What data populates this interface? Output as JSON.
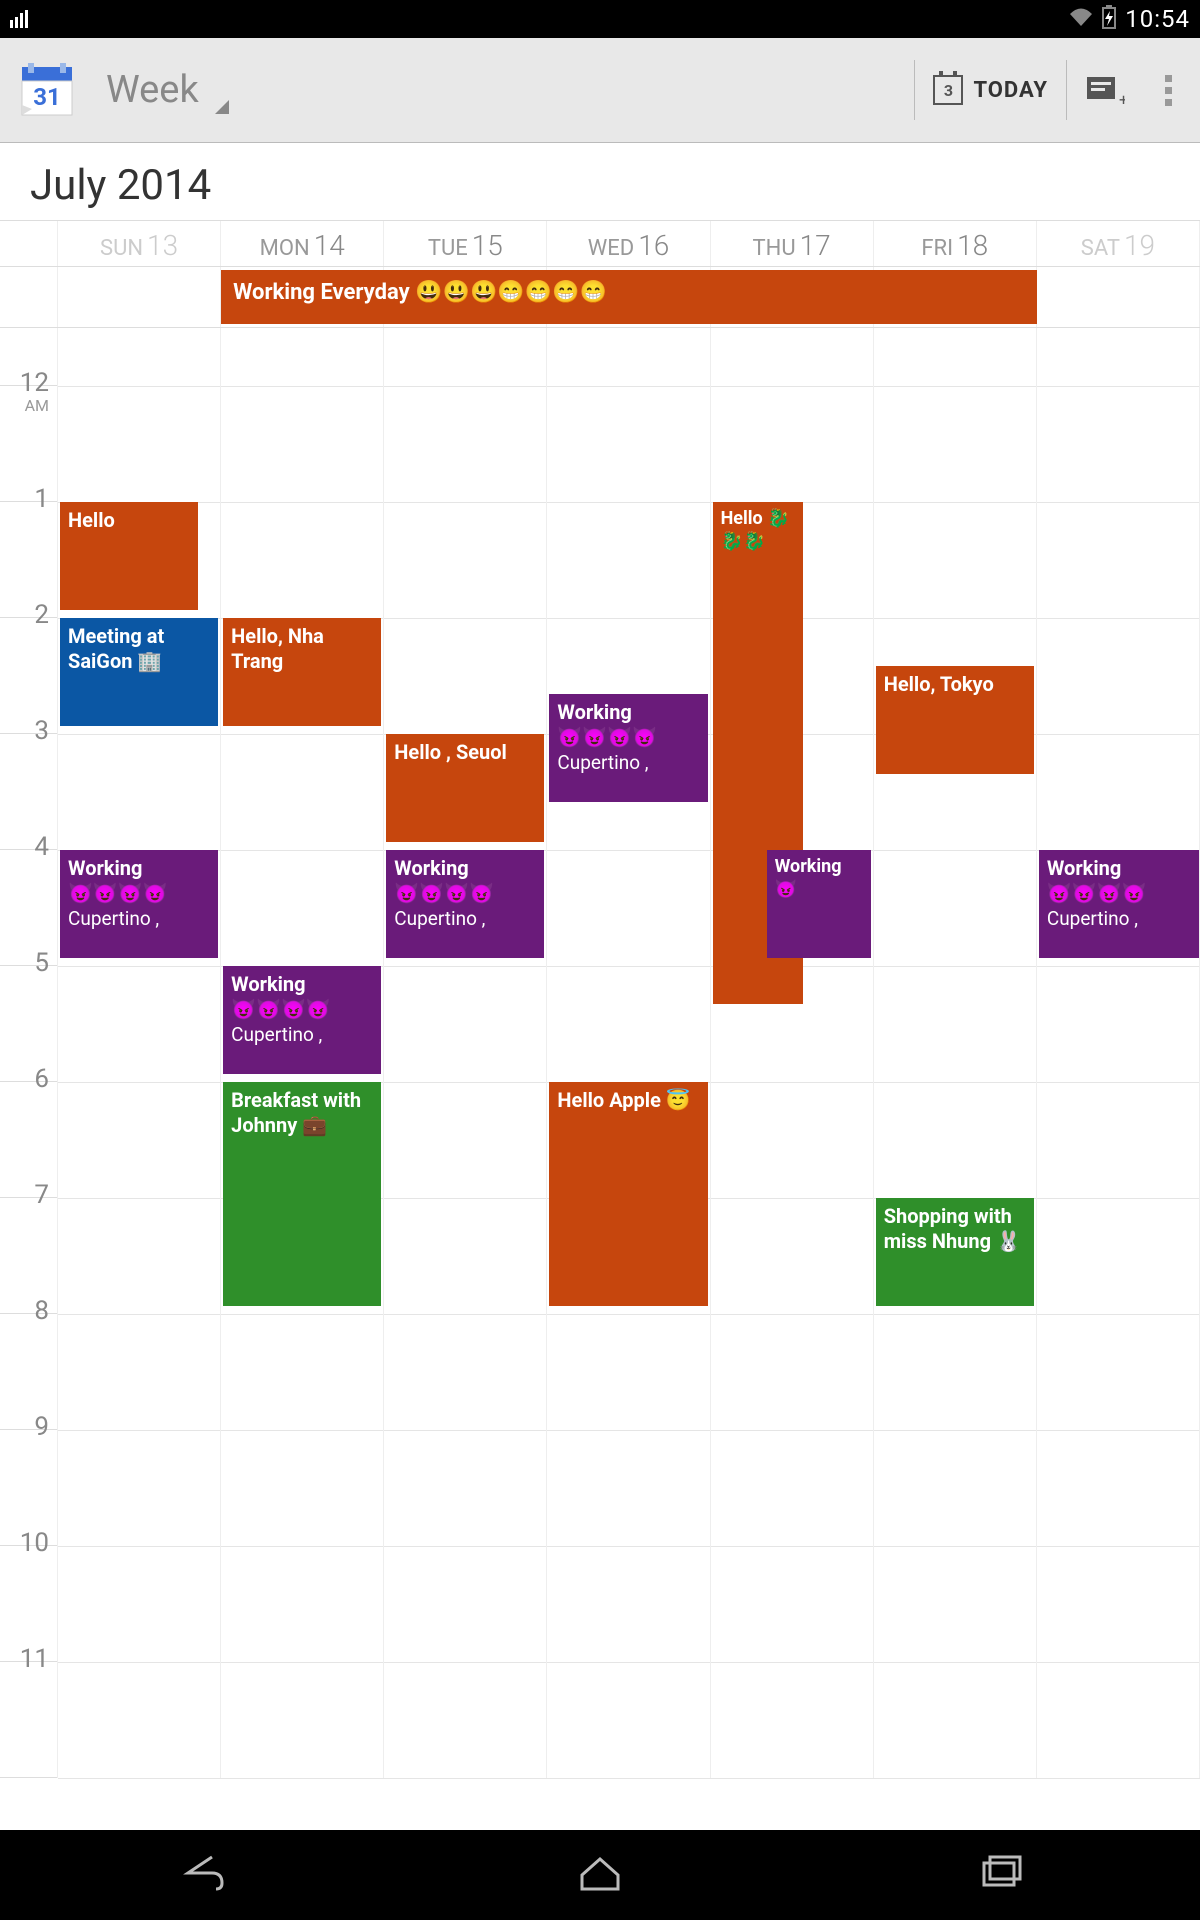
{
  "status": {
    "time": "10:54"
  },
  "appbar": {
    "view_label": "Week",
    "today_date_num": "3",
    "today_label": "TODAY"
  },
  "month_title": "July 2014",
  "days": [
    {
      "dow": "SUN",
      "num": "13",
      "weekend": true
    },
    {
      "dow": "MON",
      "num": "14",
      "weekend": false
    },
    {
      "dow": "TUE",
      "num": "15",
      "weekend": false
    },
    {
      "dow": "WED",
      "num": "16",
      "weekend": false
    },
    {
      "dow": "THU",
      "num": "17",
      "weekend": false
    },
    {
      "dow": "FRI",
      "num": "18",
      "weekend": false
    },
    {
      "dow": "SAT",
      "num": "19",
      "weekend": true
    }
  ],
  "hours": [
    {
      "label": "12",
      "suffix": "AM"
    },
    {
      "label": "1",
      "suffix": ""
    },
    {
      "label": "2",
      "suffix": ""
    },
    {
      "label": "3",
      "suffix": ""
    },
    {
      "label": "4",
      "suffix": ""
    },
    {
      "label": "5",
      "suffix": ""
    },
    {
      "label": "6",
      "suffix": ""
    },
    {
      "label": "7",
      "suffix": ""
    },
    {
      "label": "8",
      "suffix": ""
    },
    {
      "label": "9",
      "suffix": ""
    },
    {
      "label": "10",
      "suffix": ""
    },
    {
      "label": "11",
      "suffix": ""
    }
  ],
  "all_day_event": {
    "title": "Working Everyday 😃😃😃😁😁😁😁"
  },
  "events": {
    "hello_sun": "Hello",
    "meeting": "Meeting at SaiGon 🏢",
    "nhatrang": "Hello, Nha Trang",
    "seuol": "Hello , Seuol",
    "working_wed_t": "Working",
    "working_wed_e": "😈😈😈😈",
    "working_wed_l": "Cupertino ,",
    "hello_thu": "Hello 🐉🐉🐉",
    "tokyo": "Hello, Tokyo",
    "work_sun_t": "Working",
    "work_sun_e": "😈😈😈😈",
    "work_sun_l": "Cupertino ,",
    "work_tue_t": "Working",
    "work_tue_e": "😈😈😈😈",
    "work_tue_l": "Cupertino ,",
    "work_thu_t": "Working",
    "work_thu_e": "😈",
    "work_sat_t": "Working",
    "work_sat_e": "😈😈😈😈",
    "work_sat_l": "Cupertino ,",
    "work_mon_t": "Working",
    "work_mon_e": "😈😈😈😈",
    "work_mon_l": "Cupertino ,",
    "breakfast": "Breakfast with Johnny 💼",
    "apple": "Hello Apple 😇",
    "shopping": "Shopping with miss Nhung 🐰"
  }
}
